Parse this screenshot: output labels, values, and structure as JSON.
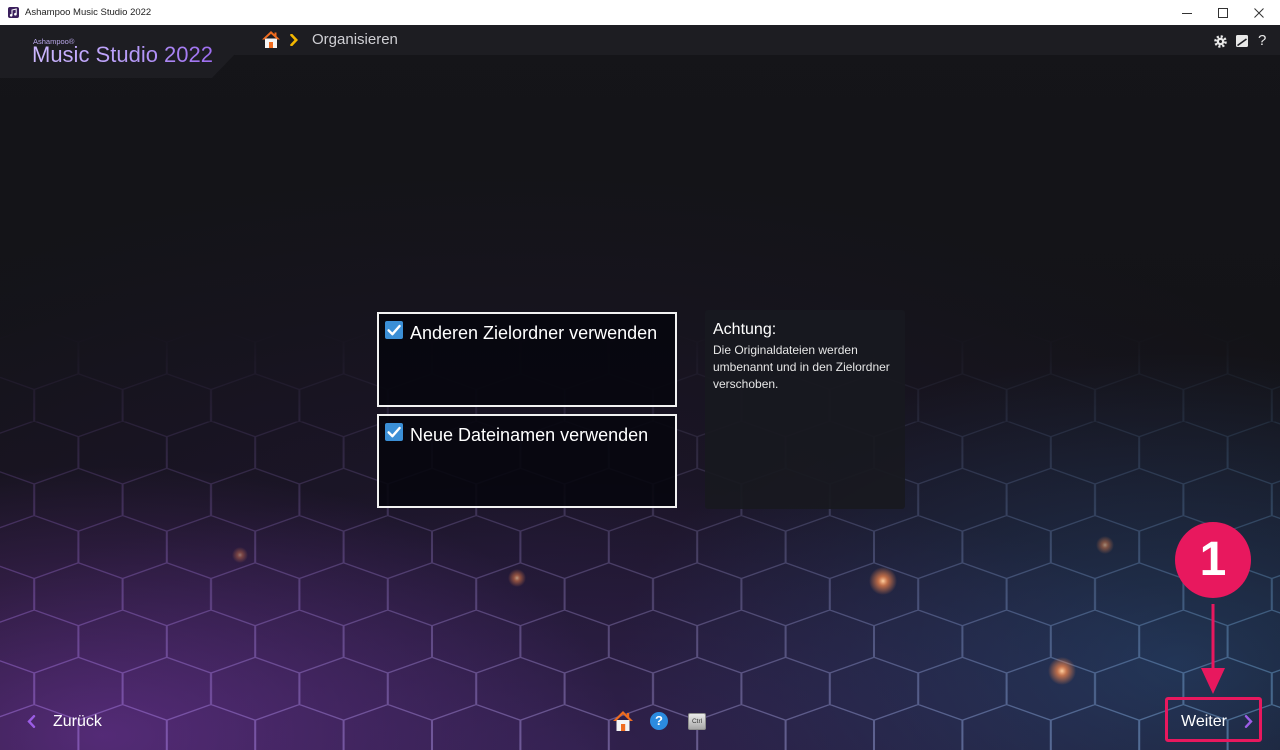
{
  "window": {
    "title": "Ashampoo Music Studio 2022",
    "app_icon": "music-app-icon",
    "controls": [
      "minimize-icon",
      "maximize-icon",
      "close-icon"
    ]
  },
  "header": {
    "brand": {
      "vendor": "Ashampoo®",
      "product": "Music Studio 2022"
    },
    "breadcrumb": {
      "home_icon": "home-icon",
      "separator_icon": "chevron-right-icon",
      "current": "Organisieren"
    },
    "tools": {
      "settings_icon": "gear-icon",
      "skin_icon": "skin-icon",
      "help_label": "?"
    }
  },
  "options": [
    {
      "label": "Anderen Zielordner verwenden",
      "checked": true
    },
    {
      "label": "Neue Dateinamen verwenden",
      "checked": true
    }
  ],
  "notice": {
    "title": "Achtung:",
    "text": "Die Originaldateien werden umbenannt und in den Zielordner verschoben."
  },
  "footer": {
    "back": {
      "icon": "chevron-left-icon",
      "label": "Zurück"
    },
    "next": {
      "icon": "chevron-right-icon",
      "label": "Weiter"
    },
    "shortcuts": {
      "home_icon": "home-icon",
      "help_label": "?",
      "keyboard_key": "Ctrl"
    }
  },
  "annotation": {
    "step": "1"
  },
  "colors": {
    "accent_purple": "#9b5de5",
    "checkbox_blue": "#3b8fd6",
    "home_orange": "#ef6c1f",
    "breadcrumb_arrow": "#f3b700",
    "annotation": "#e8185e"
  }
}
